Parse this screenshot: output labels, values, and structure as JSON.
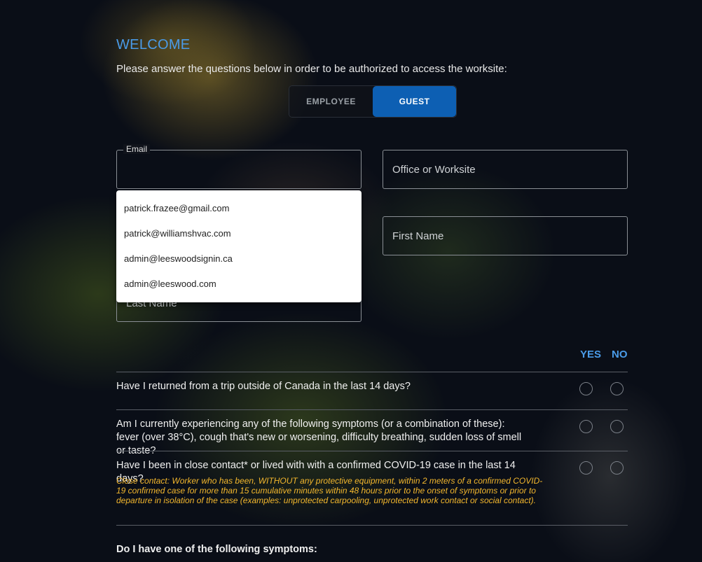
{
  "header": {
    "welcome": "WELCOME",
    "intro": "Please answer the questions below in order to be authorized to access the worksite:"
  },
  "toggle": {
    "employee": "EMPLOYEE",
    "guest": "GUEST",
    "selected": "GUEST"
  },
  "form": {
    "email_label": "Email",
    "email_value": "",
    "office_placeholder": "Office or Worksite",
    "first_name_placeholder": "First Name",
    "last_name_placeholder": "Last Name",
    "email_suggestions": [
      "patrick.frazee@gmail.com",
      "patrick@williamshvac.com",
      "admin@leeswoodsignin.ca",
      "admin@leeswood.com"
    ]
  },
  "questions": {
    "yes_label": "YES",
    "no_label": "NO",
    "items": [
      {
        "text": "Have I returned from a trip outside of Canada in the last 14 days?"
      },
      {
        "text": "Am I currently experiencing any of the following symptoms (or a combination of these): fever (over 38°C), cough that's new or worsening, difficulty breathing, sudden loss of smell or taste?"
      },
      {
        "text": "Have I been in close contact* or lived with with a confirmed COVID-19 case in the last 14 days?",
        "note": "Close contact: Worker who has been, WITHOUT any protective equipment, within 2 meters of a confirmed COVID-19 confirmed case for more than 15 cumulative minutes within 48 hours prior to the onset of symptoms or prior to departure in isolation of the case (examples: unprotected carpooling, unprotected work contact or social contact)."
      }
    ],
    "symptoms_heading": "Do I have one of the following symptoms:"
  },
  "colors": {
    "accent": "#4a9be8",
    "guest_active": "#0d5fb3",
    "note": "#f2b62d"
  }
}
